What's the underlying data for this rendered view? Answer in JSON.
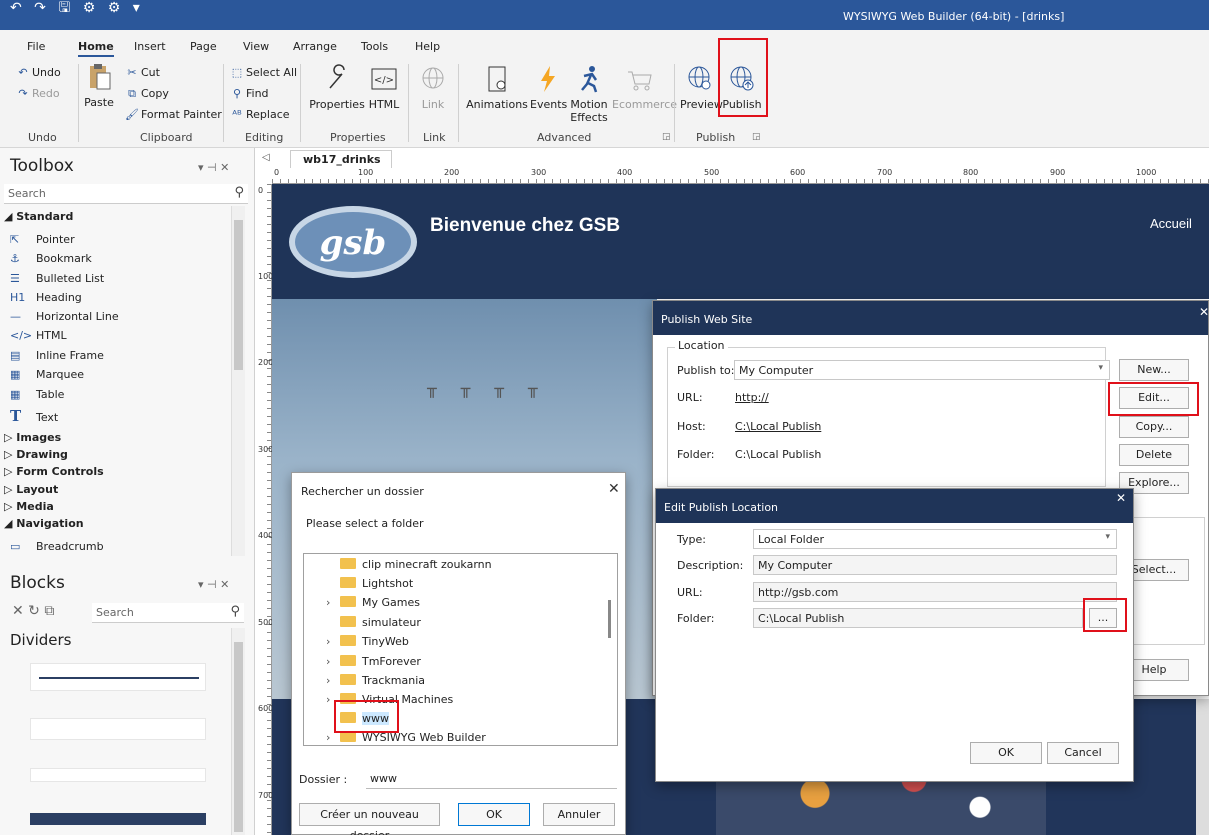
{
  "window": {
    "title": "WYSIWYG Web Builder (64-bit) - [drinks]",
    "qat_glyphs": "↶ ↷ 🖫 ⚙ ⚙ ▾"
  },
  "ribbon": {
    "tabs": [
      "File",
      "Home",
      "Insert",
      "Page",
      "View",
      "Arrange",
      "Tools",
      "Help"
    ],
    "active_tab": "Home",
    "undo": "Undo",
    "redo": "Redo",
    "paste": "Paste",
    "cut": "Cut",
    "copy": "Copy",
    "format_painter": "Format Painter",
    "select_all": "Select All",
    "find": "Find",
    "replace": "Replace",
    "properties": "Properties",
    "html": "HTML",
    "link": "Link",
    "animations": "Animations",
    "events": "Events",
    "motion_effects": "Motion Effects",
    "ecommerce": "Ecommerce",
    "preview": "Preview",
    "publish": "Publish",
    "groups": {
      "undo": "Undo",
      "clipboard": "Clipboard",
      "editing": "Editing",
      "properties": "Properties",
      "link": "Link",
      "advanced": "Advanced",
      "publish": "Publish"
    }
  },
  "toolbox": {
    "title": "Toolbox",
    "search_placeholder": "Search",
    "standard": "Standard",
    "items": [
      {
        "icon": "⇱",
        "label": "Pointer"
      },
      {
        "icon": "⚓",
        "label": "Bookmark"
      },
      {
        "icon": "☰",
        "label": "Bulleted List"
      },
      {
        "icon": "H1",
        "label": "Heading"
      },
      {
        "icon": "—",
        "label": "Horizontal Line"
      },
      {
        "icon": "</>",
        "label": "HTML"
      },
      {
        "icon": "▤",
        "label": "Inline Frame"
      },
      {
        "icon": "▦",
        "label": "Marquee"
      },
      {
        "icon": "▦",
        "label": "Table"
      },
      {
        "icon": "T",
        "label": "Text"
      }
    ],
    "categories": [
      "Images",
      "Drawing",
      "Form Controls",
      "Layout",
      "Media",
      "Navigation"
    ],
    "breadcrumb": "Breadcrumb"
  },
  "blocks": {
    "title": "Blocks",
    "search_placeholder": "Search",
    "section": "Dividers"
  },
  "document": {
    "tab_label": "wb17_drinks",
    "ruler_labels": [
      "0",
      "100",
      "200",
      "300",
      "400",
      "500",
      "600",
      "700",
      "800",
      "900",
      "1000"
    ],
    "ruler_v_labels": [
      "0",
      "100",
      "200",
      "300",
      "400",
      "500",
      "600",
      "700"
    ],
    "page_heading": "Bienvenue chez GSB",
    "nav_link": "Accueil",
    "logo_text": "gsb"
  },
  "publish_dialog": {
    "title": "Publish Web Site",
    "location_label": "Location",
    "publish_to_label": "Publish to:",
    "publish_to_value": "My Computer",
    "url_label": "URL:",
    "url_value": "http://",
    "host_label": "Host:",
    "host_value": "C:\\Local Publish",
    "folder_label": "Folder:",
    "folder_value": "C:\\Local Publish",
    "buttons": {
      "new": "New...",
      "edit": "Edit...",
      "copy": "Copy...",
      "delete": "Delete",
      "explore": "Explore...",
      "select": "Select...",
      "help": "Help"
    }
  },
  "edit_dialog": {
    "title": "Edit Publish Location",
    "type_label": "Type:",
    "type_value": "Local Folder",
    "description_label": "Description:",
    "description_value": "My Computer",
    "url_label": "URL:",
    "url_value": "http://gsb.com",
    "folder_label": "Folder:",
    "folder_value": "C:\\Local Publish",
    "browse": "...",
    "ok": "OK",
    "cancel": "Cancel"
  },
  "folder_dialog": {
    "title": "Rechercher un dossier",
    "prompt": "Please select a folder",
    "folders": [
      {
        "name": "clip minecraft zoukarnn",
        "expandable": false
      },
      {
        "name": "Lightshot",
        "expandable": false
      },
      {
        "name": "My Games",
        "expandable": true
      },
      {
        "name": "simulateur",
        "expandable": false
      },
      {
        "name": "TinyWeb",
        "expandable": true
      },
      {
        "name": "TmForever",
        "expandable": true
      },
      {
        "name": "Trackmania",
        "expandable": true
      },
      {
        "name": "Virtual Machines",
        "expandable": true
      },
      {
        "name": "www",
        "expandable": false,
        "selected": true
      },
      {
        "name": "WYSIWYG Web Builder",
        "expandable": true
      }
    ],
    "dossier_label": "Dossier :",
    "dossier_value": "www",
    "new_folder": "Créer un nouveau dossier",
    "ok": "OK",
    "cancel": "Annuler"
  },
  "colors": {
    "accent": "#2b579a",
    "header_navy": "#1f3458",
    "highlight_red": "#e0101a"
  }
}
